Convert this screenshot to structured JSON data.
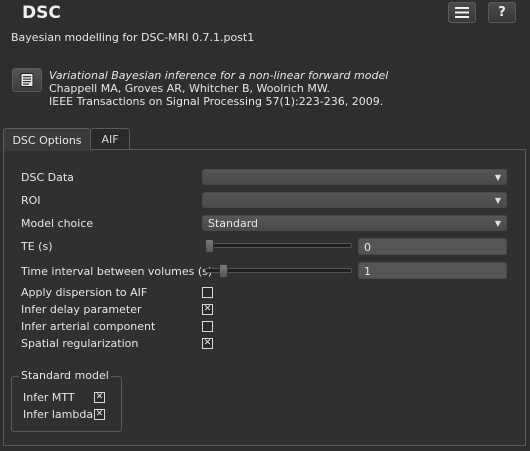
{
  "header": {
    "title": "DSC",
    "subtitle": "Bayesian modelling for DSC-MRI 0.7.1.post1",
    "menu_icon": "hamburger-menu-icon",
    "help_label": "?"
  },
  "reference": {
    "title": "Variational Bayesian inference for a non-linear forward model",
    "authors": "Chappell MA, Groves AR, Whitcher B, Woolrich MW.",
    "journal": "IEEE Transactions on Signal Processing 57(1):223-236, 2009.",
    "icon": "document-icon"
  },
  "tabs": [
    {
      "label": "DSC Options",
      "selected": true
    },
    {
      "label": "AIF",
      "selected": false
    }
  ],
  "options": {
    "dsc_data": {
      "label": "DSC Data",
      "value": ""
    },
    "roi": {
      "label": "ROI",
      "value": ""
    },
    "model_choice": {
      "label": "Model choice",
      "value": "Standard"
    },
    "te": {
      "label": "TE (s)",
      "value": "0",
      "slider_fraction": 0.0
    },
    "time_interval": {
      "label": "Time interval between volumes (s)",
      "value": "1",
      "slider_fraction": 0.1
    },
    "apply_dispersion": {
      "label": "Apply dispersion to AIF",
      "checked": false
    },
    "infer_delay": {
      "label": "Infer delay parameter",
      "checked": true
    },
    "infer_arterial": {
      "label": "Infer arterial component",
      "checked": false
    },
    "spatial_reg": {
      "label": "Spatial regularization",
      "checked": true
    }
  },
  "standard_model": {
    "title": "Standard model",
    "infer_mtt": {
      "label": "Infer MTT",
      "checked": true
    },
    "infer_lambda": {
      "label": "Infer lambda",
      "checked": true
    }
  },
  "glyphs": {
    "dropdown_arrow": "▼",
    "check_mark": "✕"
  }
}
